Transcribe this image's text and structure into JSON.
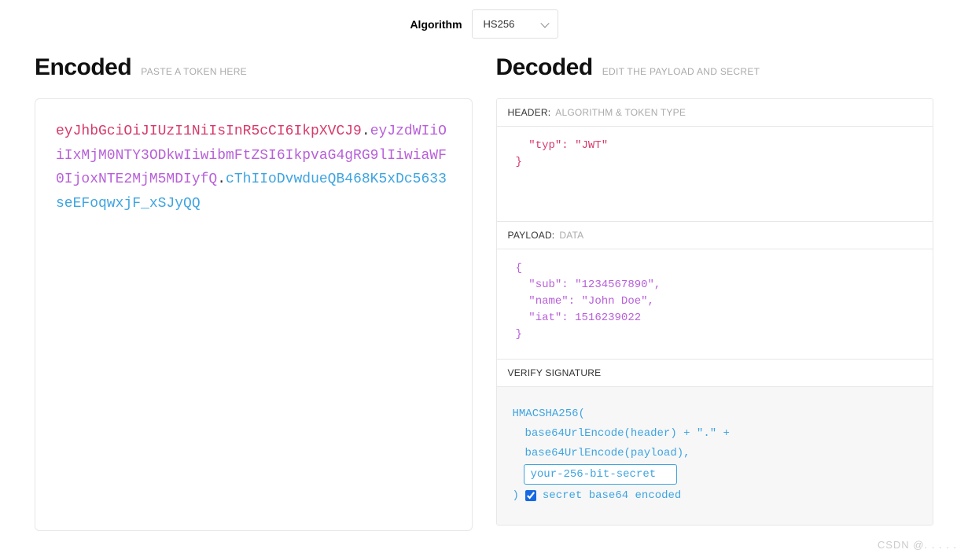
{
  "algorithm": {
    "label": "Algorithm",
    "selected": "HS256"
  },
  "encoded": {
    "title": "Encoded",
    "subtitle": "PASTE A TOKEN HERE",
    "token": {
      "header": "eyJhbGciOiJIUzI1NiIsInR5cCI6IkpXVCJ9",
      "payload": "eyJzdWIiOiIxMjM0NTY3ODkwIiwibmFtZSI6IkpvaG4gRG9lIiwiaWF0IjoxNTE2MjM5MDIyfQ",
      "signature": "cThIIoDvwdueQB468K5xDc5633seEFoqwxjF_xSJyQQ"
    }
  },
  "decoded": {
    "title": "Decoded",
    "subtitle": "EDIT THE PAYLOAD AND SECRET",
    "header_section": {
      "label": "HEADER:",
      "sublabel": "ALGORITHM & TOKEN TYPE",
      "content": "  \"typ\": \"JWT\"\n}"
    },
    "payload_section": {
      "label": "PAYLOAD:",
      "sublabel": "DATA",
      "content": "{\n  \"sub\": \"1234567890\",\n  \"name\": \"John Doe\",\n  \"iat\": 1516239022\n}"
    },
    "signature_section": {
      "label": "VERIFY SIGNATURE",
      "line1": "HMACSHA256(",
      "line2": "base64UrlEncode(header) + \".\" +",
      "line3": "base64UrlEncode(payload),",
      "secret_value": "your-256-bit-secret",
      "close_paren": ")",
      "checkbox_label": "secret base64 encoded",
      "checkbox_checked": true
    }
  },
  "watermark": "CSDN @.  . . . ."
}
